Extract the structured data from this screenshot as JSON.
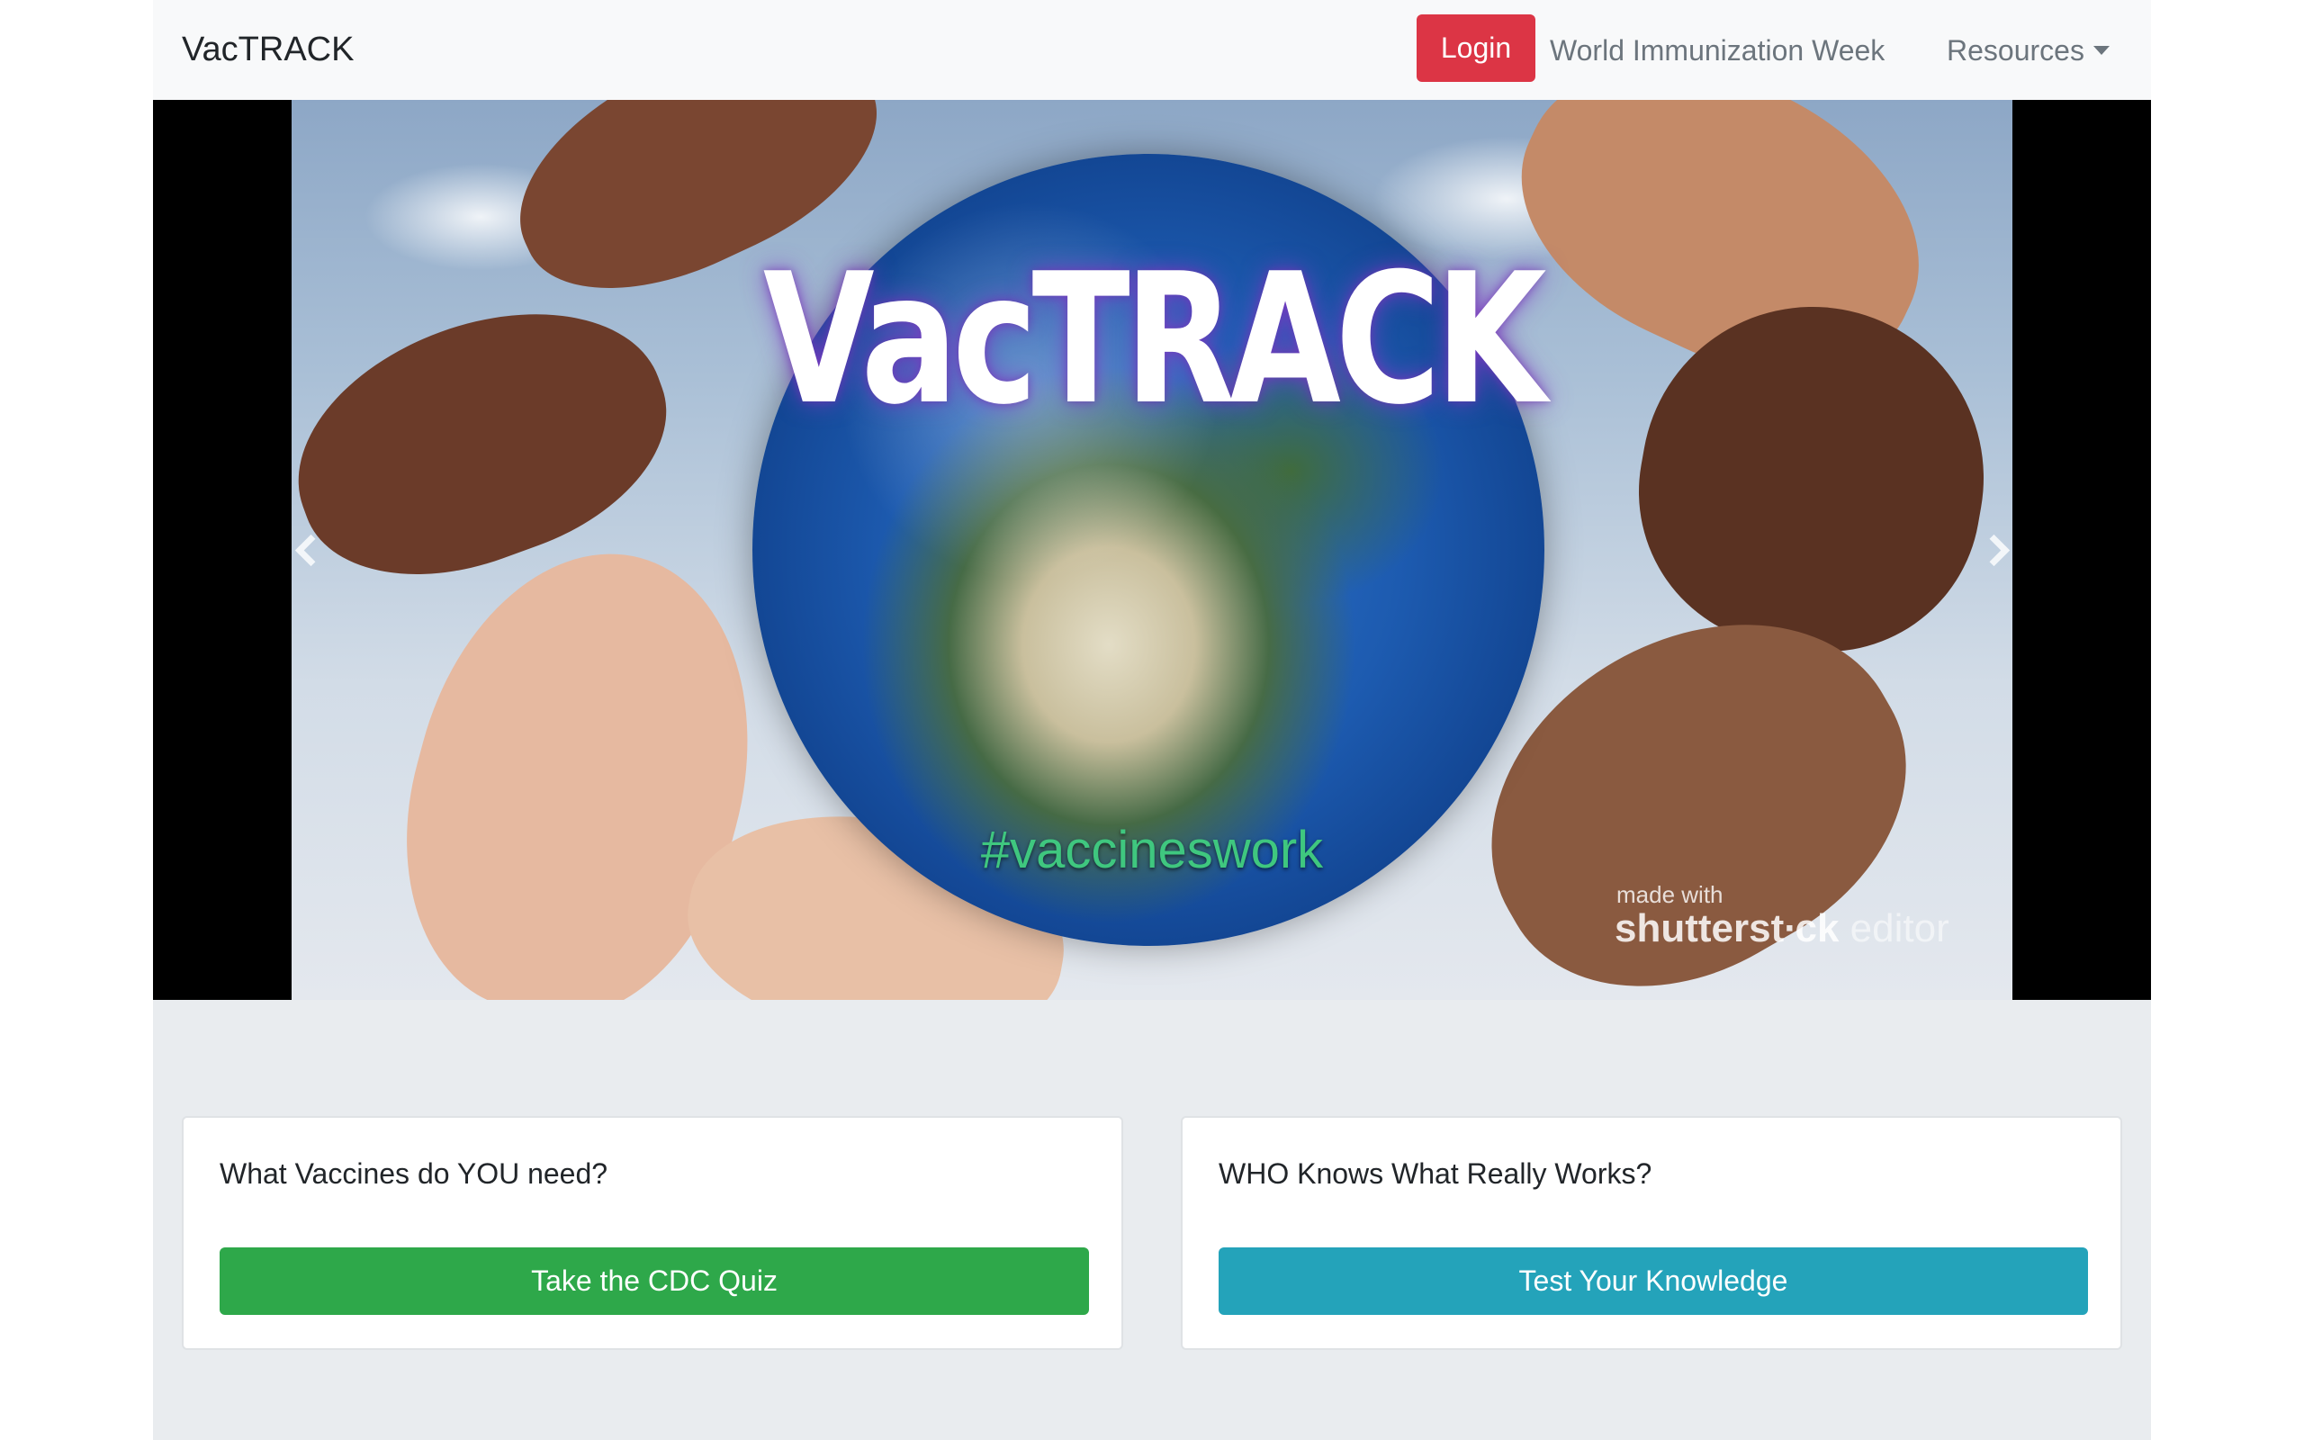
{
  "navbar": {
    "brand": "VacTRACK",
    "login_label": "Login",
    "links": [
      "World Immunization Week",
      "Resources"
    ]
  },
  "carousel": {
    "title": "VacTRACK",
    "hashtag": "#vaccineswork",
    "watermark_small": "made with",
    "watermark_brand": "shutterst∙ck",
    "watermark_editor": "editor",
    "prev_icon": "chevron-left-icon",
    "next_icon": "chevron-right-icon"
  },
  "cards": [
    {
      "text": "What Vaccines do YOU need?",
      "button": "Take the CDC Quiz",
      "color": "#2ea84a"
    },
    {
      "text": "WHO Knows What Really Works?",
      "button": "Test Your Knowledge",
      "color": "#24a3ba"
    }
  ],
  "colors": {
    "login": "#dc3545",
    "page_bg": "#e9ecef",
    "navbar_bg": "#f8f9fa"
  }
}
